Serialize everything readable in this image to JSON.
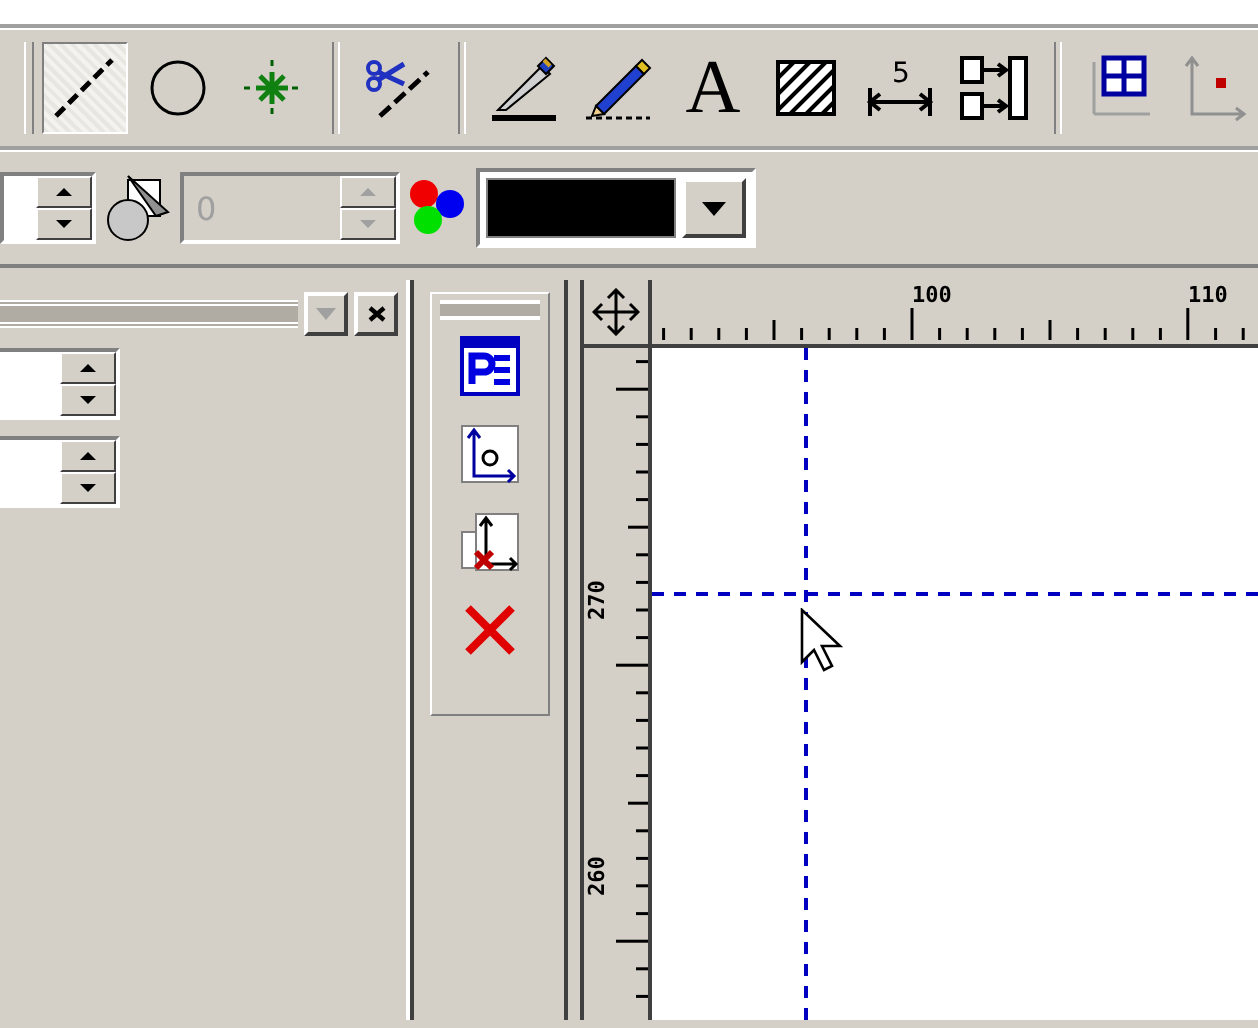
{
  "main_toolbar": {
    "tools": [
      {
        "kind": "line",
        "selected": true
      },
      {
        "kind": "circle",
        "selected": false
      },
      {
        "kind": "point",
        "selected": false
      },
      {
        "kind": "separator"
      },
      {
        "kind": "trim",
        "selected": false
      },
      {
        "kind": "separator"
      },
      {
        "kind": "pen",
        "selected": false
      },
      {
        "kind": "pencil",
        "selected": false
      },
      {
        "kind": "text",
        "selected": false,
        "label": "A"
      },
      {
        "kind": "hatch",
        "selected": false
      },
      {
        "kind": "dimension",
        "selected": false,
        "label": "5"
      },
      {
        "kind": "align",
        "selected": false
      },
      {
        "kind": "separator"
      },
      {
        "kind": "grid",
        "selected": false
      },
      {
        "kind": "axis",
        "selected": false
      }
    ]
  },
  "property_bar": {
    "layer_field": {
      "value": "0",
      "disabled": true
    },
    "color_picker": {
      "color": "#000000"
    }
  },
  "docked_panel": {
    "dropdown_disabled": true
  },
  "side_toolbar": {
    "tools": [
      {
        "kind": "properties"
      },
      {
        "kind": "origin"
      },
      {
        "kind": "delete-origin"
      },
      {
        "kind": "delete"
      }
    ]
  },
  "drawing_area": {
    "top_ruler": [
      "100",
      "110"
    ],
    "left_ruler": [
      "270",
      "260"
    ]
  }
}
